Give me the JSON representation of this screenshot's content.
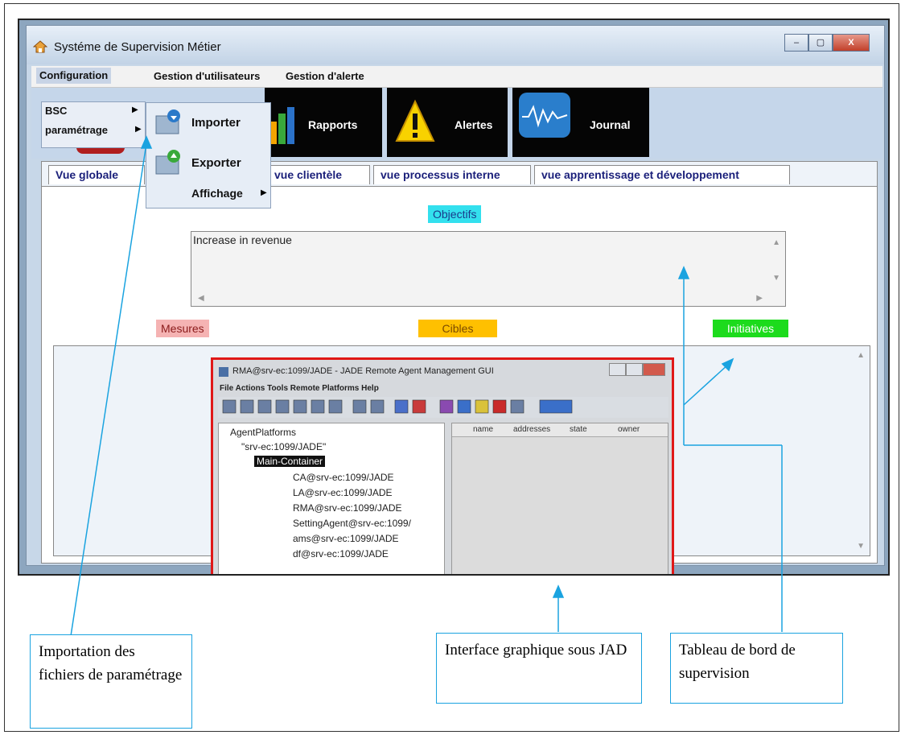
{
  "window": {
    "title": "Systéme de Supervision Métier",
    "buttons": [
      "–",
      "▢",
      "X"
    ]
  },
  "menubar": [
    "Configuration",
    "Gestion d'utilisateurs",
    "Gestion d'alerte"
  ],
  "config_menu": [
    "BSC",
    "paramétrage"
  ],
  "submenu": [
    "Importer",
    "Exporter",
    "Affichage"
  ],
  "ribbon": [
    "Rapports",
    "Alertes",
    "Journal"
  ],
  "tabs": [
    "Vue globale",
    "vue clientèle",
    "vue processus interne",
    "vue  apprentissage et développement"
  ],
  "sections": {
    "objectifs": "Objectifs",
    "mesures": "Mesures",
    "cibles": "Cibles",
    "initiatives": "Initiatives"
  },
  "textarea_value": "Increase in revenue",
  "colors": {
    "objectifs": "#33e0ee",
    "mesures": "#f5b3b3",
    "cibles": "#ffc000",
    "initiatives": "#1cdb1c",
    "highlight": "#e01818",
    "callout_border": "#1aa3e0"
  },
  "jade": {
    "title": "RMA@srv-ec:1099/JADE - JADE Remote Agent Management GUI",
    "menu": "File  Actions  Tools  Remote Platforms  Help",
    "tree": [
      "AgentPlatforms",
      "\"srv-ec:1099/JADE\"",
      "Main-Container",
      "CA@srv-ec:1099/JADE",
      "LA@srv-ec:1099/JADE",
      "RMA@srv-ec:1099/JADE",
      "SettingAgent@srv-ec:1099/",
      "ams@srv-ec:1099/JADE",
      "df@srv-ec:1099/JADE"
    ],
    "columns": [
      "name",
      "addresses",
      "state",
      "owner"
    ]
  },
  "callouts": {
    "import": "Importation des fichiers de paramétrage",
    "jade": "Interface graphique sous JAD",
    "dashboard": "Tableau de bord de supervision"
  }
}
